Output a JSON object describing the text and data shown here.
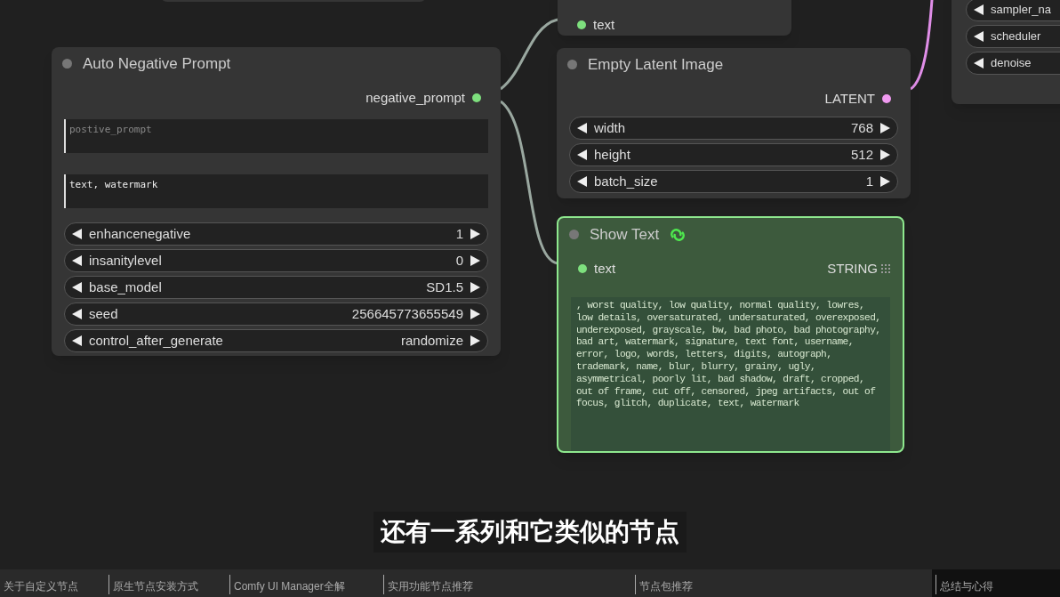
{
  "nodes": [
    {
      "kind": "partial",
      "inputs": [
        {
          "label": "text",
          "color": "#7ee07e"
        }
      ]
    },
    {
      "kind": "node",
      "title": "Auto Negative Prompt",
      "outputs": [
        {
          "label": "negative_prompt",
          "color": "#7ee07e"
        }
      ],
      "textareas": [
        {
          "placeholder": "postive_prompt"
        },
        {
          "value": "text, watermark"
        }
      ],
      "widgets": [
        {
          "name": "enhancenegative",
          "value": "1"
        },
        {
          "name": "insanitylevel",
          "value": "0"
        },
        {
          "name": "base_model",
          "value": "SD1.5"
        },
        {
          "name": "seed",
          "value": "256645773655549"
        },
        {
          "name": "control_after_generate",
          "value": "randomize"
        }
      ]
    },
    {
      "kind": "node",
      "title": "Empty Latent Image",
      "outputs": [
        {
          "label": "LATENT",
          "color": "#f09af0"
        }
      ],
      "widgets": [
        {
          "name": "width",
          "value": "768"
        },
        {
          "name": "height",
          "value": "512"
        },
        {
          "name": "batch_size",
          "value": "1"
        }
      ]
    },
    {
      "kind": "shown",
      "title": "Show Text",
      "inputs": [
        {
          "label": "text",
          "color": "#7ee07e"
        }
      ],
      "outputs": [
        {
          "label": "STRING",
          "color": "#9a9a9a"
        }
      ],
      "output_text": ", worst quality, low quality, normal quality, lowres, low details, oversaturated, undersaturated, overexposed, underexposed, grayscale, bw, bad photo, bad photography, bad art, watermark, signature, text font, username, error, logo, words, letters, digits, autograph, trademark, name, blur, blurry, grainy, ugly, asymmetrical, poorly lit, bad shadow, draft, cropped, out of frame, cut off, censored, jpeg artifacts, out of focus, glitch, duplicate, text, watermark"
    },
    {
      "kind": "edge",
      "widgets": [
        {
          "name": "sampler_na"
        },
        {
          "name": "scheduler"
        },
        {
          "name": "denoise"
        }
      ]
    }
  ],
  "subtitle": "还有一系列和它类似的节点",
  "chapters": [
    {
      "label": "关于自定义节点"
    },
    {
      "label": "原生节点安装方式"
    },
    {
      "label": "Comfy UI Manager全解"
    },
    {
      "label": "实用功能节点推荐"
    },
    {
      "label": "节点包推荐"
    },
    {
      "label": "总结与心得"
    }
  ]
}
